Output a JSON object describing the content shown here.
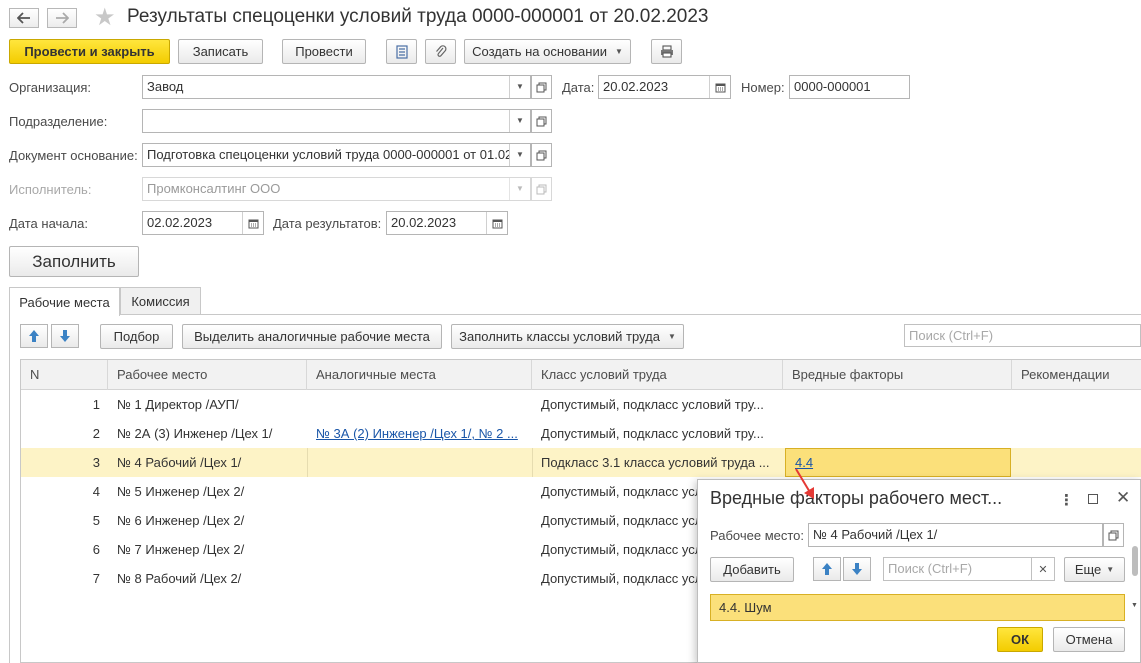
{
  "window": {
    "title": "Результаты спецоценки условий труда 0000-000001 от 20.02.2023"
  },
  "toolbar": {
    "post_close": "Провести и закрыть",
    "save": "Записать",
    "post": "Провести",
    "create_based": "Создать на основании"
  },
  "form": {
    "org_label": "Организация:",
    "org_value": "Завод",
    "date_label": "Дата:",
    "date_value": "20.02.2023",
    "number_label": "Номер:",
    "number_value": "0000-000001",
    "division_label": "Подразделение:",
    "division_value": "",
    "basis_label": "Документ основание:",
    "basis_value": "Подготовка спецоценки условий труда 0000-000001 от 01.02",
    "executor_label": "Исполнитель:",
    "executor_value": "Промконсалтинг ООО",
    "start_label": "Дата начала:",
    "start_value": "02.02.2023",
    "results_label": "Дата результатов:",
    "results_value": "20.02.2023",
    "fill_button": "Заполнить"
  },
  "tabs": [
    {
      "label": "Рабочие места",
      "active": true
    },
    {
      "label": "Комиссия",
      "active": false
    }
  ],
  "table_toolbar": {
    "pick": "Подбор",
    "highlight_similar": "Выделить аналогичные рабочие места",
    "fill_classes": "Заполнить классы условий труда",
    "search_placeholder": "Поиск (Ctrl+F)"
  },
  "table": {
    "columns": [
      "N",
      "Рабочее место",
      "Аналогичные места",
      "Класс условий труда",
      "Вредные факторы",
      "Рекомендации"
    ],
    "rows": [
      {
        "n": "1",
        "place": "№ 1 Директор /АУП/",
        "similar": "",
        "class": "Допустимый, подкласс условий тру...",
        "factors": "",
        "recommendations": ""
      },
      {
        "n": "2",
        "place": "№ 2А (3) Инженер /Цех 1/",
        "similar": "№ 3А (2) Инженер /Цех 1/, № 2 ...",
        "class": "Допустимый, подкласс условий тру...",
        "factors": "",
        "recommendations": ""
      },
      {
        "n": "3",
        "place": "№ 4 Рабочий /Цех 1/",
        "similar": "",
        "class": "Подкласс 3.1 класса условий труда ...",
        "factors": "4.4",
        "recommendations": "",
        "selected": true
      },
      {
        "n": "4",
        "place": "№ 5 Инженер /Цех 2/",
        "similar": "",
        "class": "Допустимый, подкласс условий тру...",
        "factors": "",
        "recommendations": ""
      },
      {
        "n": "5",
        "place": "№ 6 Инженер /Цех 2/",
        "similar": "",
        "class": "Допустимый, подкласс условий тру...",
        "factors": "",
        "recommendations": ""
      },
      {
        "n": "6",
        "place": "№ 7 Инженер /Цех 2/",
        "similar": "",
        "class": "Допустимый, подкласс условий тру...",
        "factors": "",
        "recommendations": ""
      },
      {
        "n": "7",
        "place": "№ 8 Рабочий /Цех 2/",
        "similar": "",
        "class": "Допустимый, подкласс условий тру...",
        "factors": "",
        "recommendations": ""
      }
    ]
  },
  "popup": {
    "title": "Вредные факторы рабочего мест...",
    "workplace_label": "Рабочее место:",
    "workplace_value": "№ 4 Рабочий /Цех 1/",
    "add": "Добавить",
    "search_placeholder": "Поиск (Ctrl+F)",
    "more": "Еще",
    "factor": "4.4. Шум",
    "ok": "ОК",
    "cancel": "Отмена"
  },
  "colors": {
    "primary_button": "#f5d000",
    "selected_row": "#fdf3c6",
    "active_cell": "#fbe07a",
    "link": "#1a56a8",
    "arrow_icon": "#3b82c4",
    "pointer_arrow": "#e53935"
  }
}
